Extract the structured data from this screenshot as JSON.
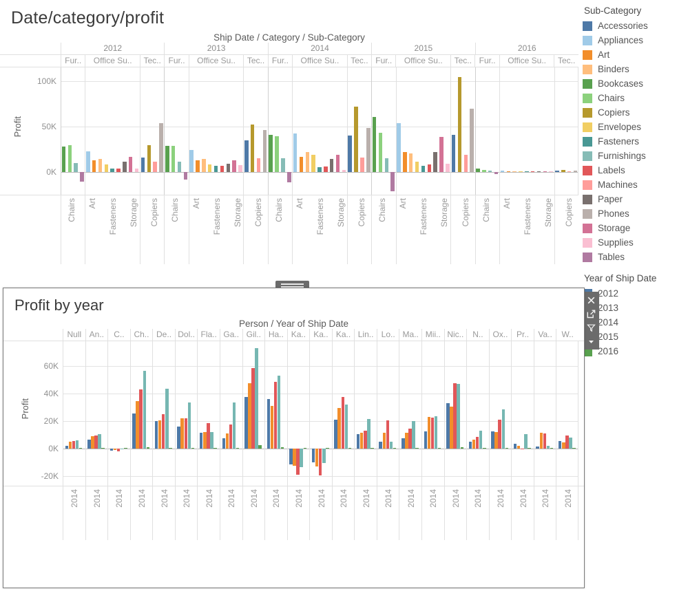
{
  "top_sheet": {
    "title": "Date/category/profit",
    "field_caption": "Ship Date / Category / Sub-Category",
    "y_axis_label": "Profit",
    "y_ticks": [
      "100K",
      "50K",
      "0K"
    ]
  },
  "bottom_sheet": {
    "title": "Profit by year",
    "field_caption": "Person / Year of Ship Date",
    "y_axis_label": "Profit",
    "y_ticks": [
      "60K",
      "40K",
      "20K",
      "0K",
      "-20K"
    ]
  },
  "legend": {
    "title": "Sub-Category",
    "items": [
      {
        "label": "Accessories",
        "color": "#4e79a7"
      },
      {
        "label": "Appliances",
        "color": "#a0cbe8"
      },
      {
        "label": "Art",
        "color": "#f28e2b"
      },
      {
        "label": "Binders",
        "color": "#ffbe7d"
      },
      {
        "label": "Bookcases",
        "color": "#59a14f"
      },
      {
        "label": "Chairs",
        "color": "#8cd17d"
      },
      {
        "label": "Copiers",
        "color": "#b6992d"
      },
      {
        "label": "Envelopes",
        "color": "#f1ce63"
      },
      {
        "label": "Fasteners",
        "color": "#499894"
      },
      {
        "label": "Furnishings",
        "color": "#86bcb6"
      },
      {
        "label": "Labels",
        "color": "#e15759"
      },
      {
        "label": "Machines",
        "color": "#ff9d9a"
      },
      {
        "label": "Paper",
        "color": "#79706e"
      },
      {
        "label": "Phones",
        "color": "#bab0ac"
      },
      {
        "label": "Storage",
        "color": "#d37295"
      },
      {
        "label": "Supplies",
        "color": "#fabfd2"
      },
      {
        "label": "Tables",
        "color": "#b07aa1"
      }
    ]
  },
  "year_legend": {
    "title": "Year of Ship Date",
    "items": [
      {
        "label": "2012",
        "color": "#4e79a7"
      },
      {
        "label": "2013",
        "color": "#f28e2b"
      },
      {
        "label": "2014",
        "color": "#e15759"
      },
      {
        "label": "2015",
        "color": "#76b7b2"
      },
      {
        "label": "2016",
        "color": "#59a14f"
      }
    ]
  },
  "sheet_toolbar": {
    "buttons": [
      {
        "name": "close-icon",
        "tooltip": "Remove"
      },
      {
        "name": "export-icon",
        "tooltip": "Go to Sheet"
      },
      {
        "name": "filter-funnel-icon",
        "tooltip": "Use as Filter"
      },
      {
        "name": "chevron-down-icon",
        "tooltip": "More Options"
      }
    ]
  },
  "chart_data": [
    {
      "id": "date-category-profit",
      "type": "bar",
      "title": "Date/category/profit",
      "xlabel": "Ship Date / Category / Sub-Category",
      "ylabel": "Profit",
      "ylim": [
        -25000,
        115000
      ],
      "y_ticks": [
        0,
        50000,
        100000
      ],
      "grid": true,
      "legend_position": "right",
      "years": [
        "2012",
        "2013",
        "2014",
        "2015",
        "2016"
      ],
      "categories": [
        "Fur..",
        "Office Su..",
        "Tec.."
      ],
      "subcategory_axis_labels": [
        "Chairs",
        "Art",
        "Fasteners",
        "Storage",
        "Copiers"
      ],
      "groups": [
        {
          "year": "2012",
          "category": "Fur..",
          "bars": [
            {
              "sub": "Bookcases",
              "value": 28000
            },
            {
              "sub": "Chairs",
              "value": 29500
            },
            {
              "sub": "Furnishings",
              "value": 9500
            },
            {
              "sub": "Tables",
              "value": -10500
            }
          ]
        },
        {
          "year": "2012",
          "category": "Office Su..",
          "bars": [
            {
              "sub": "Appliances",
              "value": 23000
            },
            {
              "sub": "Art",
              "value": 13000
            },
            {
              "sub": "Binders",
              "value": 14500
            },
            {
              "sub": "Envelopes",
              "value": 8000
            },
            {
              "sub": "Fasteners",
              "value": 3500
            },
            {
              "sub": "Labels",
              "value": 4000
            },
            {
              "sub": "Paper",
              "value": 11000
            },
            {
              "sub": "Storage",
              "value": 16500
            },
            {
              "sub": "Supplies",
              "value": 3500
            }
          ]
        },
        {
          "year": "2012",
          "category": "Tec..",
          "bars": [
            {
              "sub": "Accessories",
              "value": 16000
            },
            {
              "sub": "Copiers",
              "value": 29500
            },
            {
              "sub": "Machines",
              "value": 11000
            },
            {
              "sub": "Phones",
              "value": 53500
            }
          ]
        },
        {
          "year": "2013",
          "category": "Fur..",
          "bars": [
            {
              "sub": "Bookcases",
              "value": 28500
            },
            {
              "sub": "Chairs",
              "value": 29000
            },
            {
              "sub": "Furnishings",
              "value": 11500
            },
            {
              "sub": "Tables",
              "value": -8500
            }
          ]
        },
        {
          "year": "2013",
          "category": "Office Su..",
          "bars": [
            {
              "sub": "Appliances",
              "value": 24500
            },
            {
              "sub": "Art",
              "value": 13000
            },
            {
              "sub": "Binders",
              "value": 14000
            },
            {
              "sub": "Envelopes",
              "value": 8500
            },
            {
              "sub": "Fasteners",
              "value": 6500
            },
            {
              "sub": "Labels",
              "value": 6500
            },
            {
              "sub": "Paper",
              "value": 9000
            },
            {
              "sub": "Storage",
              "value": 12500
            },
            {
              "sub": "Supplies",
              "value": 7500
            }
          ]
        },
        {
          "year": "2013",
          "category": "Tec..",
          "bars": [
            {
              "sub": "Accessories",
              "value": 35000
            },
            {
              "sub": "Copiers",
              "value": 52000
            },
            {
              "sub": "Machines",
              "value": 15000
            },
            {
              "sub": "Phones",
              "value": 46500
            }
          ]
        },
        {
          "year": "2014",
          "category": "Fur..",
          "bars": [
            {
              "sub": "Bookcases",
              "value": 41000
            },
            {
              "sub": "Chairs",
              "value": 39500
            },
            {
              "sub": "Furnishings",
              "value": 15500
            },
            {
              "sub": "Tables",
              "value": -11500
            }
          ]
        },
        {
          "year": "2014",
          "category": "Office Su..",
          "bars": [
            {
              "sub": "Appliances",
              "value": 42500
            },
            {
              "sub": "Art",
              "value": 17000
            },
            {
              "sub": "Binders",
              "value": 22000
            },
            {
              "sub": "Envelopes",
              "value": 19000
            },
            {
              "sub": "Fasteners",
              "value": 5500
            },
            {
              "sub": "Labels",
              "value": 6000
            },
            {
              "sub": "Paper",
              "value": 14500
            },
            {
              "sub": "Storage",
              "value": 19000
            },
            {
              "sub": "Supplies",
              "value": 2500
            }
          ]
        },
        {
          "year": "2014",
          "category": "Tec..",
          "bars": [
            {
              "sub": "Accessories",
              "value": 40000
            },
            {
              "sub": "Copiers",
              "value": 72000
            },
            {
              "sub": "Machines",
              "value": 16000
            },
            {
              "sub": "Phones",
              "value": 48500
            }
          ]
        },
        {
          "year": "2015",
          "category": "Fur..",
          "bars": [
            {
              "sub": "Bookcases",
              "value": 60500
            },
            {
              "sub": "Chairs",
              "value": 43000
            },
            {
              "sub": "Furnishings",
              "value": 15500
            },
            {
              "sub": "Tables",
              "value": -21000
            }
          ]
        },
        {
          "year": "2015",
          "category": "Office Su..",
          "bars": [
            {
              "sub": "Appliances",
              "value": 53500
            },
            {
              "sub": "Art",
              "value": 22000
            },
            {
              "sub": "Binders",
              "value": 20500
            },
            {
              "sub": "Envelopes",
              "value": 11000
            },
            {
              "sub": "Fasteners",
              "value": 7000
            },
            {
              "sub": "Labels",
              "value": 8000
            },
            {
              "sub": "Paper",
              "value": 22000
            },
            {
              "sub": "Storage",
              "value": 38500
            },
            {
              "sub": "Supplies",
              "value": 9000
            }
          ]
        },
        {
          "year": "2015",
          "category": "Tec..",
          "bars": [
            {
              "sub": "Accessories",
              "value": 40500
            },
            {
              "sub": "Copiers",
              "value": 104500
            },
            {
              "sub": "Machines",
              "value": 19000
            },
            {
              "sub": "Phones",
              "value": 69500
            }
          ]
        },
        {
          "year": "2016",
          "category": "Fur..",
          "bars": [
            {
              "sub": "Bookcases",
              "value": 3500
            },
            {
              "sub": "Chairs",
              "value": 2000
            },
            {
              "sub": "Furnishings",
              "value": 1500
            },
            {
              "sub": "Tables",
              "value": -2000
            }
          ]
        },
        {
          "year": "2016",
          "category": "Office Su..",
          "bars": [
            {
              "sub": "Appliances",
              "value": 1500
            },
            {
              "sub": "Art",
              "value": 800
            },
            {
              "sub": "Binders",
              "value": 900
            },
            {
              "sub": "Envelopes",
              "value": 500
            },
            {
              "sub": "Fasteners",
              "value": 300
            },
            {
              "sub": "Labels",
              "value": 400
            },
            {
              "sub": "Paper",
              "value": 900
            },
            {
              "sub": "Storage",
              "value": 1100
            },
            {
              "sub": "Supplies",
              "value": 300
            }
          ]
        },
        {
          "year": "2016",
          "category": "Tec..",
          "bars": [
            {
              "sub": "Accessories",
              "value": 1200
            },
            {
              "sub": "Copiers",
              "value": 2200
            },
            {
              "sub": "Machines",
              "value": 700
            },
            {
              "sub": "Phones",
              "value": 1600
            }
          ]
        }
      ]
    },
    {
      "id": "profit-by-year",
      "type": "bar",
      "title": "Profit by year",
      "xlabel": "Person / Year of Ship Date",
      "ylabel": "Profit",
      "ylim": [
        -27000,
        78000
      ],
      "y_ticks": [
        -20000,
        0,
        20000,
        40000,
        60000
      ],
      "grid": true,
      "series": [
        "2012",
        "2013",
        "2014",
        "2015",
        "2016"
      ],
      "tick_label": "2014",
      "people": [
        {
          "label": "Null",
          "values": [
            2000,
            5000,
            5500,
            6000,
            300
          ]
        },
        {
          "label": "An..",
          "values": [
            6500,
            9000,
            9500,
            10500,
            500
          ]
        },
        {
          "label": "C..",
          "values": [
            -1500,
            -1200,
            -1800,
            -700,
            200
          ]
        },
        {
          "label": "Ch..",
          "values": [
            25500,
            34500,
            43000,
            56500,
            1000
          ]
        },
        {
          "label": "De..",
          "values": [
            20000,
            20500,
            25000,
            43500,
            700
          ]
        },
        {
          "label": "Dol..",
          "values": [
            16000,
            22000,
            22000,
            33500,
            600
          ]
        },
        {
          "label": "Fla..",
          "values": [
            11500,
            12000,
            18500,
            12000,
            400
          ]
        },
        {
          "label": "Ga..",
          "values": [
            7500,
            11000,
            17500,
            33500,
            500
          ]
        },
        {
          "label": "Gil..",
          "values": [
            37500,
            47500,
            58500,
            73000,
            2500
          ]
        },
        {
          "label": "Ha..",
          "values": [
            36000,
            31000,
            48500,
            53000,
            800
          ]
        },
        {
          "label": "Ka..",
          "values": [
            -11500,
            -12500,
            -19000,
            -13500,
            300
          ]
        },
        {
          "label": "Ka..",
          "values": [
            -10000,
            -13000,
            -19500,
            -10500,
            400
          ]
        },
        {
          "label": "Ka..",
          "values": [
            21000,
            29500,
            37500,
            32000,
            600
          ]
        },
        {
          "label": "Lin..",
          "values": [
            10500,
            11500,
            13000,
            21500,
            400
          ]
        },
        {
          "label": "Lo..",
          "values": [
            5000,
            11500,
            20500,
            5000,
            300
          ]
        },
        {
          "label": "Ma..",
          "values": [
            7500,
            11500,
            14500,
            20000,
            500
          ]
        },
        {
          "label": "Mii..",
          "values": [
            12500,
            23000,
            22500,
            23500,
            600
          ]
        },
        {
          "label": "Nic..",
          "values": [
            33000,
            30500,
            47500,
            47000,
            900
          ]
        },
        {
          "label": "N..",
          "values": [
            5000,
            6500,
            8500,
            13000,
            400
          ]
        },
        {
          "label": "Ox..",
          "values": [
            12500,
            12000,
            21000,
            28500,
            500
          ]
        },
        {
          "label": "Pr..",
          "values": [
            3500,
            2000,
            -500,
            10500,
            300
          ]
        },
        {
          "label": "Va..",
          "values": [
            1500,
            11500,
            11000,
            2000,
            600
          ]
        },
        {
          "label": "W..",
          "values": [
            5500,
            4500,
            9500,
            8000,
            300
          ]
        }
      ]
    }
  ]
}
